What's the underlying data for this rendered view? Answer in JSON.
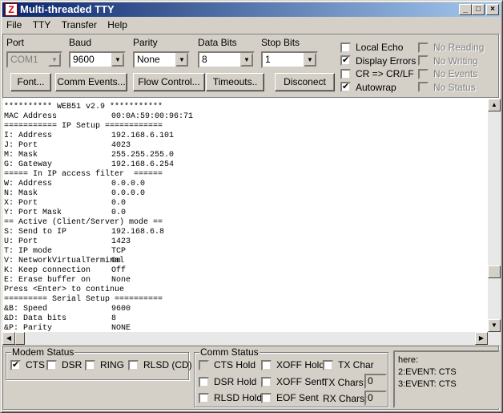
{
  "window": {
    "title": "Multi-threaded TTY",
    "min": "_",
    "max": "□",
    "close": "×"
  },
  "menu": [
    "File",
    "TTY",
    "Transfer",
    "Help"
  ],
  "settings": {
    "port": {
      "label": "Port",
      "value": "COM1"
    },
    "baud": {
      "label": "Baud",
      "value": "9600"
    },
    "parity": {
      "label": "Parity",
      "value": "None"
    },
    "data_bits": {
      "label": "Data Bits",
      "value": "8"
    },
    "stop_bits": {
      "label": "Stop Bits",
      "value": "1"
    }
  },
  "buttons": [
    "Font...",
    "Comm Events...",
    "Flow Control...",
    "Timeouts..",
    "Disconect"
  ],
  "options": [
    {
      "label": "Local Echo",
      "checked": false
    },
    {
      "label": "Display Errors",
      "checked": true
    },
    {
      "label": "CR => CR/LF",
      "checked": false
    },
    {
      "label": "Autowrap",
      "checked": true
    }
  ],
  "disabled_options": [
    "No Reading",
    "No Writing",
    "No Events",
    "No Status"
  ],
  "terminal": [
    [
      "********** WEB51 v2.9 ***********",
      ""
    ],
    [
      "MAC Address",
      "00:0A:59:00:96:71"
    ],
    [
      "=========== IP Setup ============",
      ""
    ],
    [
      "I: Address",
      "192.168.6.101"
    ],
    [
      "J: Port",
      "4023"
    ],
    [
      "M: Mask",
      "255.255.255.0"
    ],
    [
      "G: Gateway",
      "192.168.6.254"
    ],
    [
      "===== In IP access filter  ======",
      ""
    ],
    [
      "W: Address",
      "0.0.0.0"
    ],
    [
      "N: Mask",
      "0.0.0.0"
    ],
    [
      "X: Port",
      "0.0"
    ],
    [
      "Y: Port Mask",
      "0.0"
    ],
    [
      "== Active (Client/Server) mode ==",
      ""
    ],
    [
      "S: Send to IP",
      "192.168.6.8"
    ],
    [
      "U: Port",
      "1423"
    ],
    [
      "T: IP mode",
      "TCP"
    ],
    [
      "V: NetworkVirtualTerminal",
      "On"
    ],
    [
      "K: Keep connection",
      "Off"
    ],
    [
      "E: Erase buffer on",
      "None"
    ],
    [
      "Press <Enter> to continue",
      ""
    ],
    [
      "========= Serial Setup ==========",
      ""
    ],
    [
      "&B: Speed",
      "9600"
    ],
    [
      "&D: Data bits",
      "8"
    ],
    [
      "&P: Parity",
      "NONE"
    ]
  ],
  "modem_status": {
    "caption": "Modem Status",
    "items": [
      {
        "label": "CTS",
        "checked": true
      },
      {
        "label": "DSR",
        "checked": false
      },
      {
        "label": "RING",
        "checked": false
      },
      {
        "label": "RLSD (CD)",
        "checked": false
      }
    ]
  },
  "comm_status": {
    "caption": "Comm Status",
    "cts_hold": "CTS Hold",
    "xoff_hold": "XOFF Hold",
    "tx_char": "TX Char",
    "dsr_hold": "DSR Hold",
    "xoff_sent": "XOFF Sent",
    "rlsd_hold": "RLSD Hold",
    "eof_sent": "EOF Sent",
    "tx_chars_label": "TX Chars:",
    "tx_chars": "0",
    "rx_chars_label": "RX Chars:",
    "rx_chars": "0"
  },
  "event_log": [
    "here:",
    "2:EVENT: CTS",
    "3:EVENT: CTS"
  ]
}
